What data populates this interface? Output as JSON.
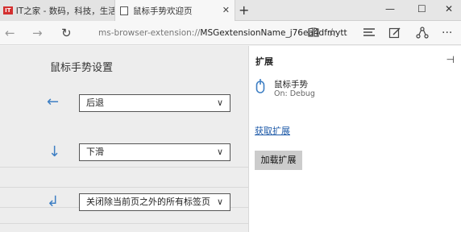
{
  "tabs": [
    {
      "favicon": "IT",
      "title": "IT之家 - 数码，科技，生活"
    },
    {
      "title": "鼠标手势欢迎页",
      "close": "✕"
    }
  ],
  "new_tab": "+",
  "window_controls": {
    "minimize": "—",
    "maximize": "☐",
    "close": "✕"
  },
  "nav": {
    "back": "←",
    "forward": "→",
    "refresh": "↻"
  },
  "address": {
    "url_prefix": "ms-browser-extension://",
    "url_host": "MSGextensionName_j76ea4dfmytt"
  },
  "page": {
    "title": "鼠标手势设置",
    "gestures": [
      {
        "arrow": "←",
        "action": "后退"
      },
      {
        "arrow": "↓",
        "action": "下滑"
      },
      {
        "arrow": "↲",
        "action": "关闭除当前页之外的所有标签页"
      }
    ]
  },
  "extensions_panel": {
    "title": "扩展",
    "extension": {
      "name": "鼠标手势",
      "status": "On: Debug"
    },
    "get_extensions": "获取扩展",
    "load_extension": "加载扩展"
  },
  "colors": {
    "accent": "#3e7fc4",
    "link": "#1e5aa8"
  }
}
